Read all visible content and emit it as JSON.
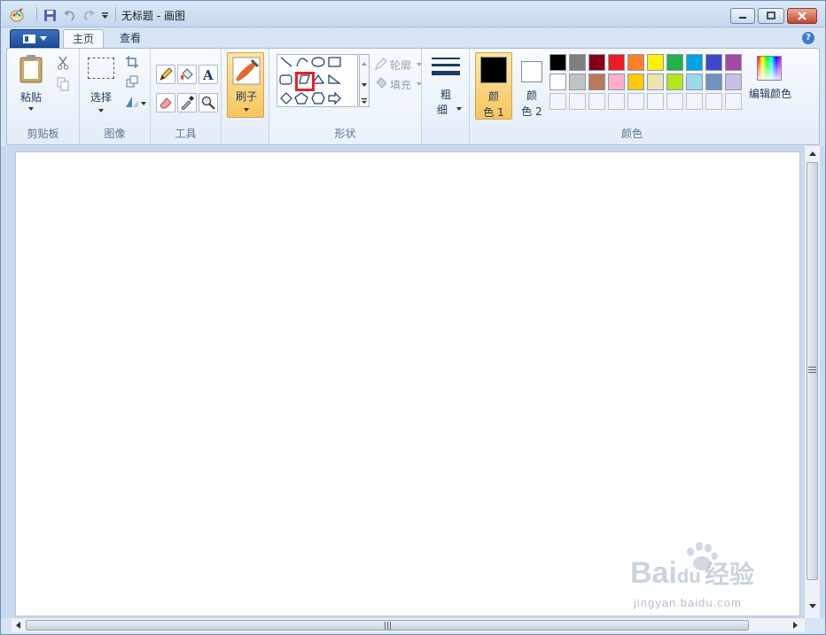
{
  "window": {
    "title": "无标题 - 画图"
  },
  "tabs": [
    {
      "label": "主页",
      "active": true
    },
    {
      "label": "查看",
      "active": false
    }
  ],
  "help_label": "?",
  "groups": {
    "clipboard": {
      "label": "剪贴板",
      "paste_label": "粘贴"
    },
    "image": {
      "label": "图像",
      "select_label": "选择"
    },
    "tools": {
      "label": "工具"
    },
    "brushes": {
      "label_line1": "刷子"
    },
    "shapes": {
      "label": "形状",
      "outline_label": "轮廓",
      "fill_label": "填充"
    },
    "size": {
      "label_line1": "粗",
      "label_line2": "细"
    },
    "colors": {
      "label": "颜色",
      "color1_line1": "颜",
      "color1_line2": "色 1",
      "color2_line1": "颜",
      "color2_line2": "色 2",
      "edit_label": "编辑颜色",
      "palette_row1": [
        "#000000",
        "#7f7f7f",
        "#880015",
        "#ed1c24",
        "#ff7f27",
        "#fff200",
        "#22b14c",
        "#00a2e8",
        "#3f48cc",
        "#a349a4"
      ],
      "palette_row2": [
        "#ffffff",
        "#c3c3c3",
        "#b97a57",
        "#ffaec9",
        "#ffc90e",
        "#efe4b0",
        "#b5e61d",
        "#99d9ea",
        "#7092be",
        "#c8bfe7"
      ],
      "color1_value": "#000000",
      "color2_value": "#ffffff"
    }
  },
  "watermark": {
    "brand": "Bai",
    "paw": "du",
    "suffix": "经验",
    "url": "jingyan.baidu.com"
  },
  "accent_colors": {
    "selected_tool": "#fbd17a",
    "highlight_box": "#e8202a"
  }
}
